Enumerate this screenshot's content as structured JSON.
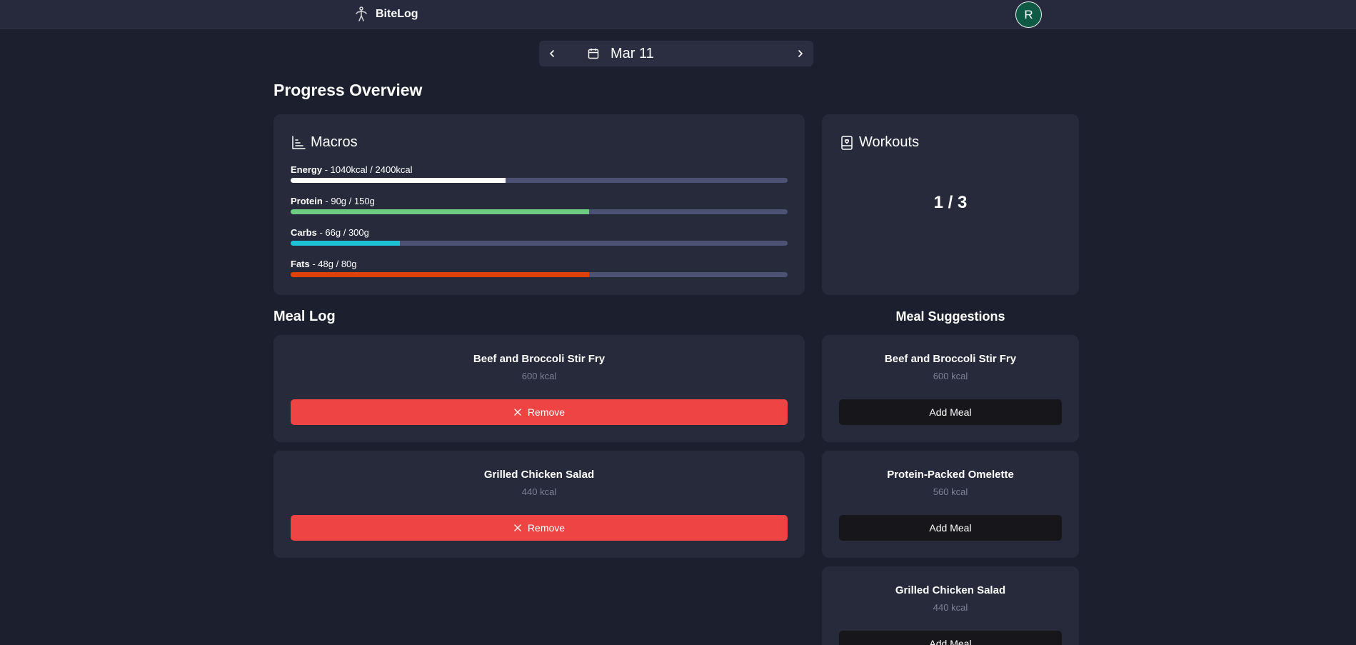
{
  "app": {
    "name": "BiteLog",
    "logo_icon": "running-figure-icon"
  },
  "user": {
    "avatar_initial": "R",
    "avatar_color": "#0f5a44"
  },
  "date_nav": {
    "label": "Mar 11",
    "prev_icon": "chevron-left-icon",
    "next_icon": "chevron-right-icon",
    "calendar_icon": "calendar-icon"
  },
  "progress": {
    "title": "Progress Overview",
    "macros": {
      "title": "Macros",
      "icon": "bar-chart-icon",
      "items": [
        {
          "name": "Energy",
          "detail": " - 1040kcal / 2400kcal",
          "fraction": 0.433,
          "color": "#ffffff"
        },
        {
          "name": "Protein",
          "detail": " - 90g / 150g",
          "fraction": 0.6,
          "color": "#6ecb82"
        },
        {
          "name": "Carbs",
          "detail": " - 66g / 300g",
          "fraction": 0.22,
          "color": "#1ec0d6"
        },
        {
          "name": "Fats",
          "detail": " - 48g / 80g",
          "fraction": 0.6,
          "color": "#e0420c"
        }
      ]
    },
    "workouts": {
      "title": "Workouts",
      "icon": "fitness-tracker-icon",
      "count": "1 / 3"
    }
  },
  "meal_log": {
    "title": "Meal Log",
    "remove_label": "Remove",
    "items": [
      {
        "name": "Beef and Broccoli Stir Fry",
        "kcal": "600 kcal"
      },
      {
        "name": "Grilled Chicken Salad",
        "kcal": "440 kcal"
      }
    ]
  },
  "suggestions": {
    "title": "Meal Suggestions",
    "add_label": "Add Meal",
    "items": [
      {
        "name": "Beef and Broccoli Stir Fry",
        "kcal": "600 kcal"
      },
      {
        "name": "Protein-Packed Omelette",
        "kcal": "560 kcal"
      },
      {
        "name": "Grilled Chicken Salad",
        "kcal": "440 kcal"
      }
    ]
  }
}
